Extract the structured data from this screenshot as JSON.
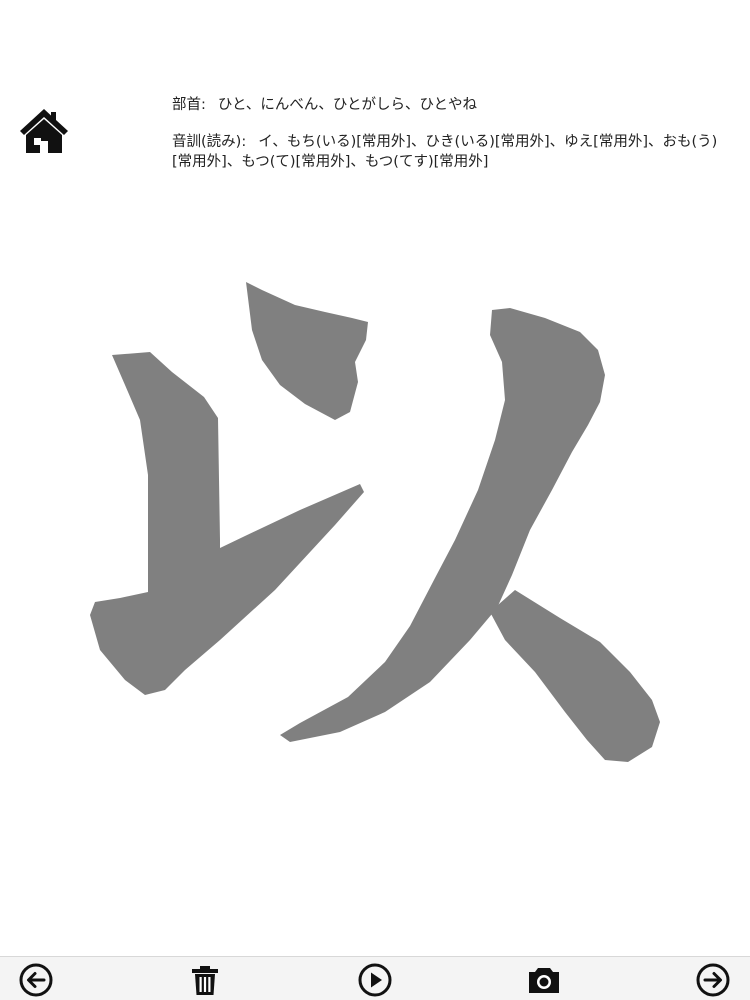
{
  "header": {
    "bushu_label": "部首:",
    "bushu_value": "ひと、にんべん、ひとがしら、ひとやね",
    "onkun_label": "音訓(読み):",
    "onkun_value": "イ、もち(いる)[常用外]、ひき(いる)[常用外]、ゆえ[常用外]、おも(う)[常用外]、もつ(て)[常用外]、もつ(てす)[常用外]"
  },
  "kanji": {
    "character": "以",
    "fill_color": "#808080"
  },
  "toolbar": {
    "items": [
      {
        "icon": "arrow-left-circle-icon"
      },
      {
        "icon": "trash-icon"
      },
      {
        "icon": "play-circle-icon"
      },
      {
        "icon": "camera-icon"
      },
      {
        "icon": "arrow-right-circle-icon"
      }
    ]
  },
  "colors": {
    "icon": "#111111",
    "toolbar_bg": "#f4f4f4"
  }
}
